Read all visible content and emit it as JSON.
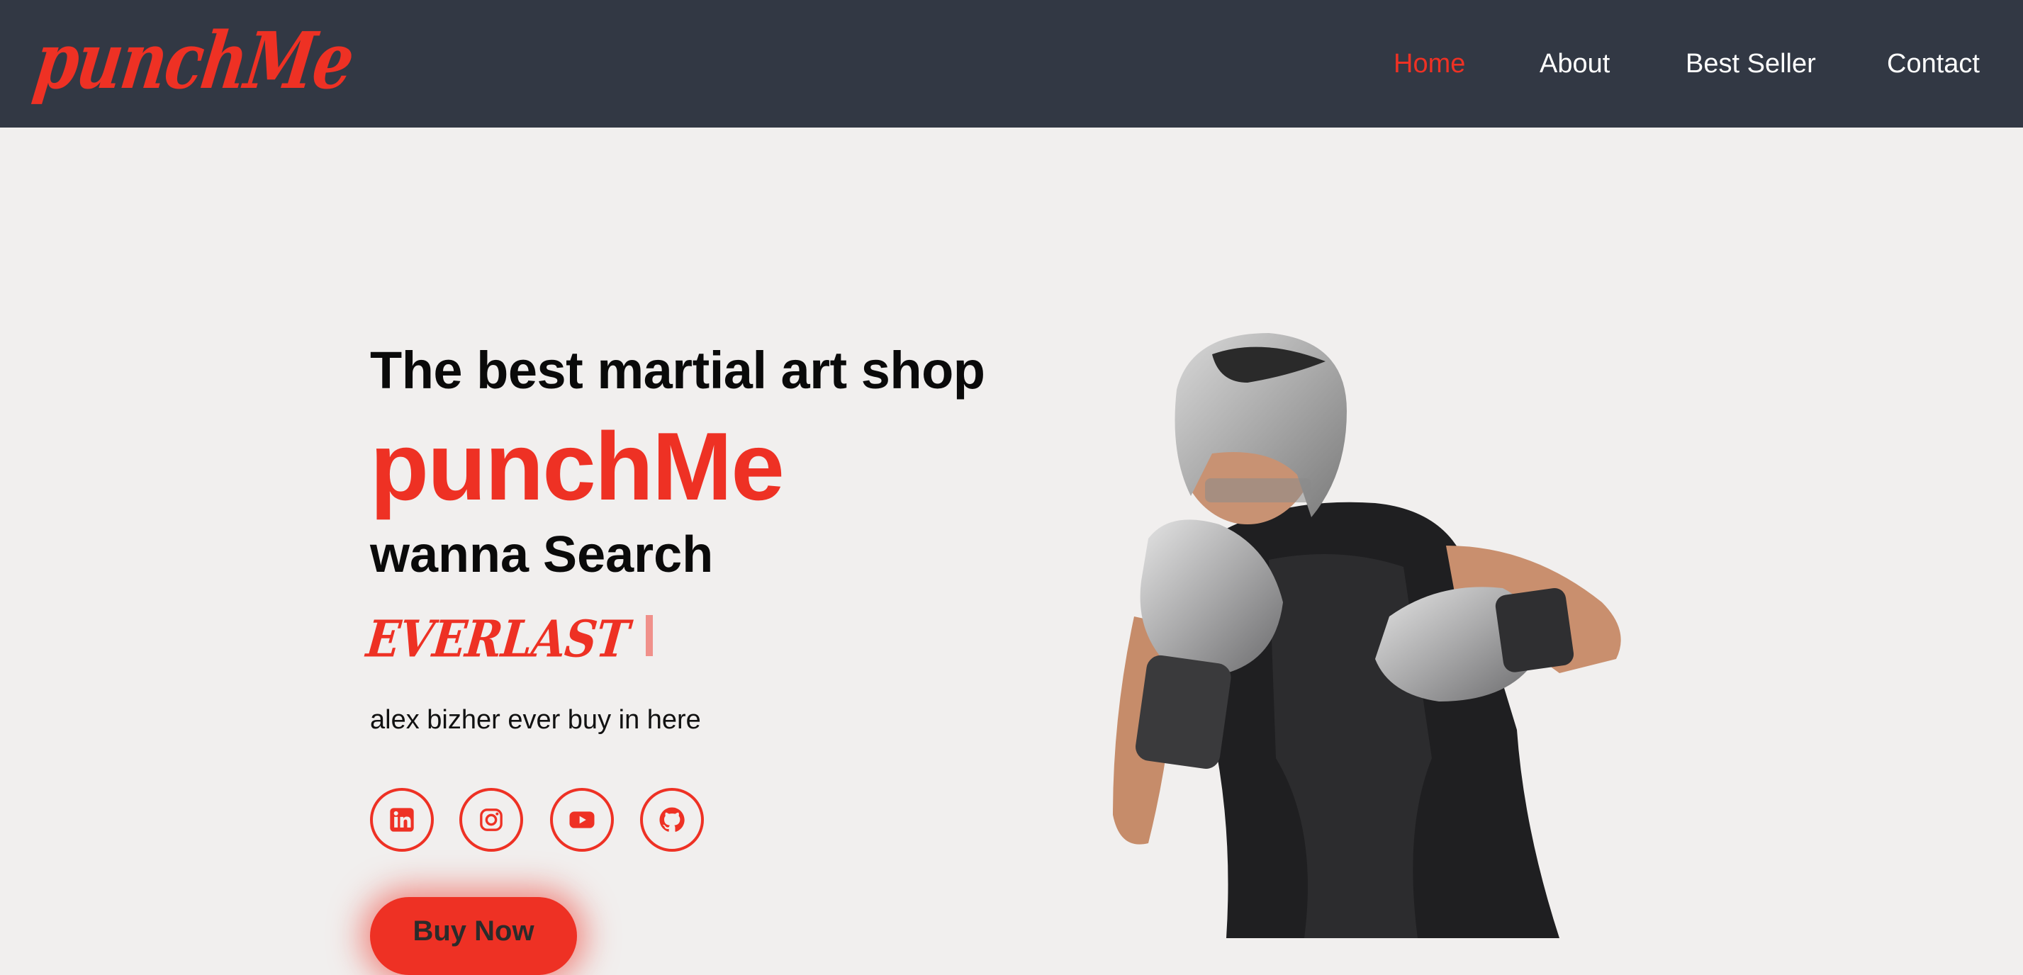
{
  "navbar": {
    "logo_text": "punchMe",
    "links": [
      {
        "label": "Home",
        "active": true
      },
      {
        "label": "About",
        "active": false
      },
      {
        "label": "Best Seller",
        "active": false
      },
      {
        "label": "Contact",
        "active": false
      }
    ]
  },
  "hero": {
    "tagline": "The best martial art shop",
    "brand": "punchMe",
    "search_label": "wanna Search",
    "typed_text": "EVERLAST",
    "subtext": "alex bizher ever buy in here",
    "socials": [
      {
        "icon": "linkedin-icon"
      },
      {
        "icon": "instagram-icon"
      },
      {
        "icon": "youtube-icon"
      },
      {
        "icon": "github-icon"
      }
    ],
    "cta_label": "Buy Now"
  },
  "colors": {
    "navbar_bg": "#323844",
    "page_bg": "#f1efee",
    "accent": "#ee3124",
    "text_dark": "#0a0a0a",
    "nav_text": "#ffffff"
  }
}
